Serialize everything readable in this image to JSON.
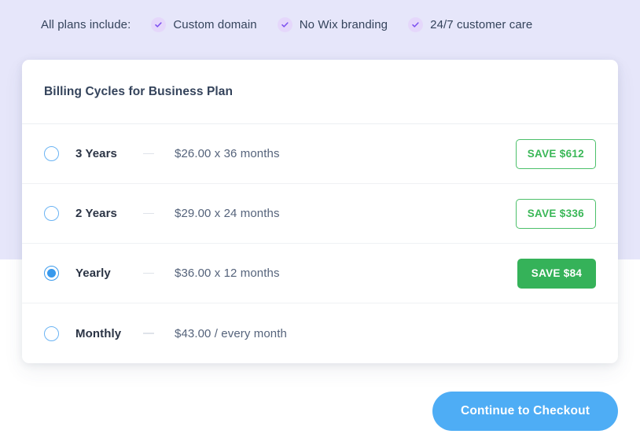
{
  "banner": {
    "intro": "All plans include:",
    "features": [
      {
        "icon": "check-icon",
        "label": "Custom domain"
      },
      {
        "icon": "check-icon",
        "label": "No Wix branding"
      },
      {
        "icon": "check-icon",
        "label": "24/7 customer care"
      }
    ]
  },
  "card": {
    "title": "Billing Cycles for Business Plan",
    "options": [
      {
        "label": "3 Years",
        "price": "$26.00 x 36 months",
        "badge": "SAVE $612",
        "selected": false,
        "badge_style": "outline"
      },
      {
        "label": "2 Years",
        "price": "$29.00 x 24 months",
        "badge": "SAVE $336",
        "selected": false,
        "badge_style": "outline"
      },
      {
        "label": "Yearly",
        "price": "$36.00 x 12 months",
        "badge": "SAVE $84",
        "selected": true,
        "badge_style": "solid"
      },
      {
        "label": "Monthly",
        "price": "$43.00 / every month",
        "badge": "",
        "selected": false,
        "badge_style": "none"
      }
    ]
  },
  "footer": {
    "checkout_label": "Continue to Checkout"
  },
  "colors": {
    "band": "#e6e6fa",
    "feature_chip": "#e5d7fb",
    "check_purple": "#8b5cf6",
    "text_dark": "#34435b",
    "text_price": "#55637b",
    "radio_blue": "#3899ec",
    "save_green": "#35b259",
    "save_green_outline": "#4cc06a",
    "cta_blue": "#4eadf5"
  }
}
